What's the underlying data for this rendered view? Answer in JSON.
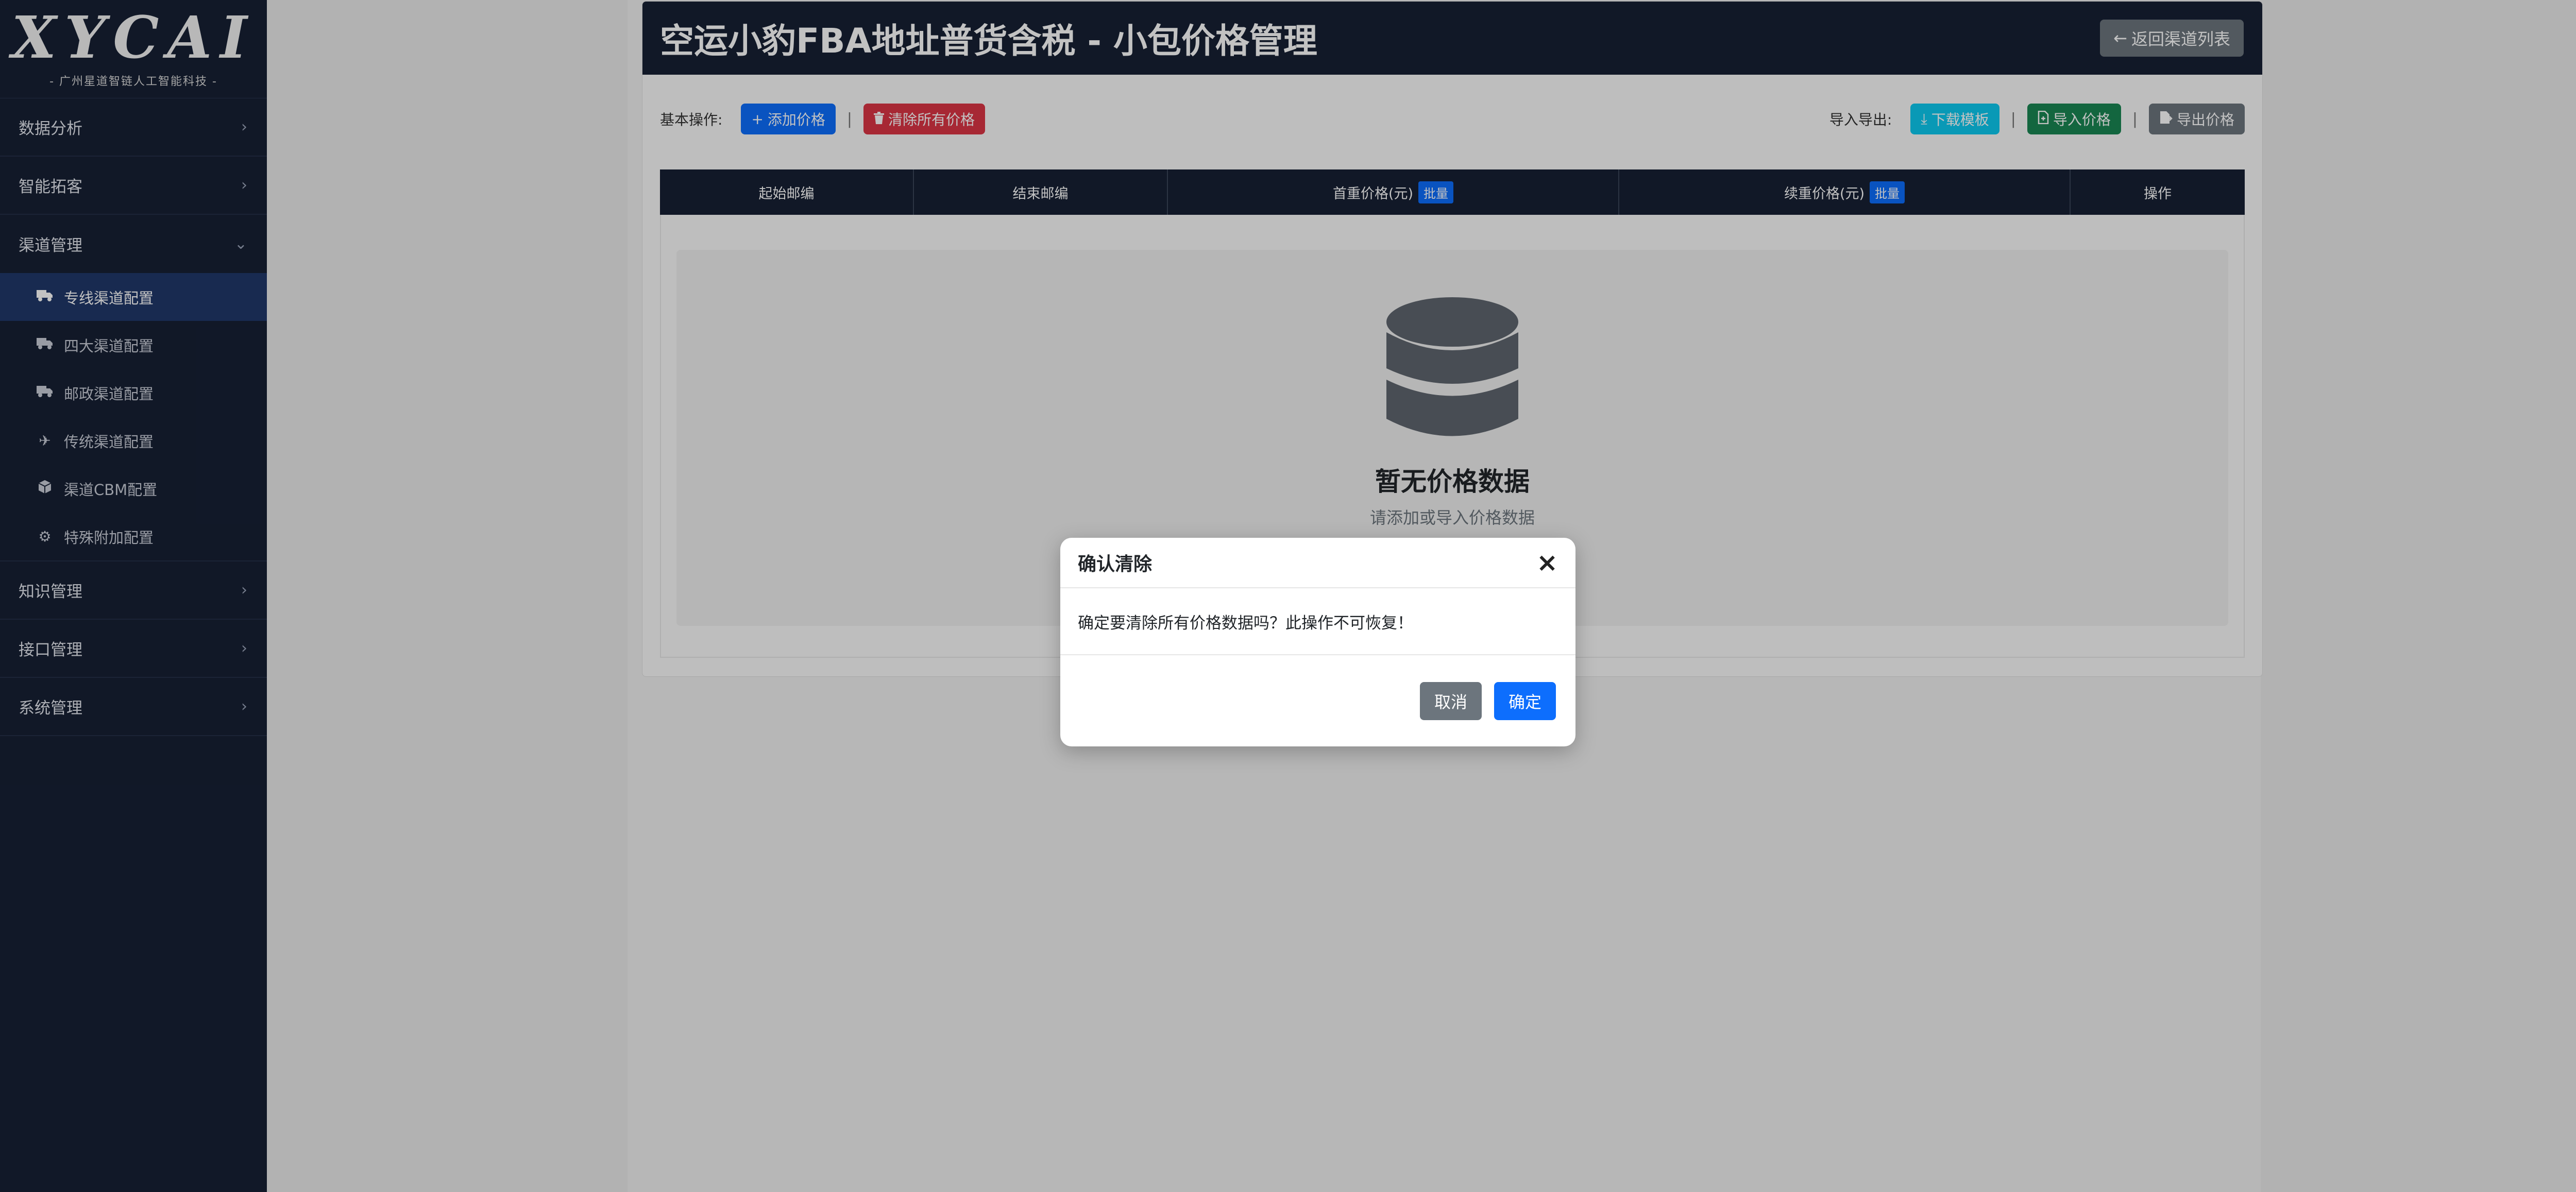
{
  "sidebar": {
    "logo": "XYCAI",
    "logo_sub": "- 广州星道智链人工智能科技 -",
    "groups": [
      {
        "label": "数据分析"
      },
      {
        "label": "智能拓客"
      },
      {
        "label": "渠道管理",
        "expanded": true,
        "items": [
          {
            "label": "专线渠道配置",
            "icon": "truck-icon",
            "active": true
          },
          {
            "label": "四大渠道配置",
            "icon": "truck-icon"
          },
          {
            "label": "邮政渠道配置",
            "icon": "truck-icon"
          },
          {
            "label": "传统渠道配置",
            "icon": "plane-icon"
          },
          {
            "label": "渠道CBM配置",
            "icon": "box-icon"
          },
          {
            "label": "特殊附加配置",
            "icon": "gear-icon"
          }
        ]
      },
      {
        "label": "知识管理"
      },
      {
        "label": "接口管理"
      },
      {
        "label": "系统管理"
      }
    ]
  },
  "header": {
    "title": "空运小豹FBA地址普货含税 - 小包价格管理",
    "back_label": "返回渠道列表"
  },
  "toolbar": {
    "basic_label": "基本操作:",
    "add_label": "添加价格",
    "clear_label": "清除所有价格",
    "sep": "|",
    "io_label": "导入导出:",
    "download_label": "下载模板",
    "import_label": "导入价格",
    "export_label": "导出价格"
  },
  "table": {
    "columns": [
      "起始邮编",
      "结束邮编",
      "首重价格(元)",
      "续重价格(元)",
      "操作"
    ],
    "batch_label": "批量"
  },
  "empty": {
    "title": "暂无价格数据",
    "subtitle": "请添加或导入价格数据"
  },
  "modal": {
    "title": "确认清除",
    "close": "×",
    "message": "确定要清除所有价格数据吗？此操作不可恢复！",
    "cancel_label": "取消",
    "confirm_label": "确定"
  },
  "colors": {
    "sidebar_bg": "#172034",
    "primary": "#0d6efd",
    "danger": "#dc3545",
    "info": "#0dcaf0",
    "success": "#198754",
    "secondary": "#6c757d"
  }
}
